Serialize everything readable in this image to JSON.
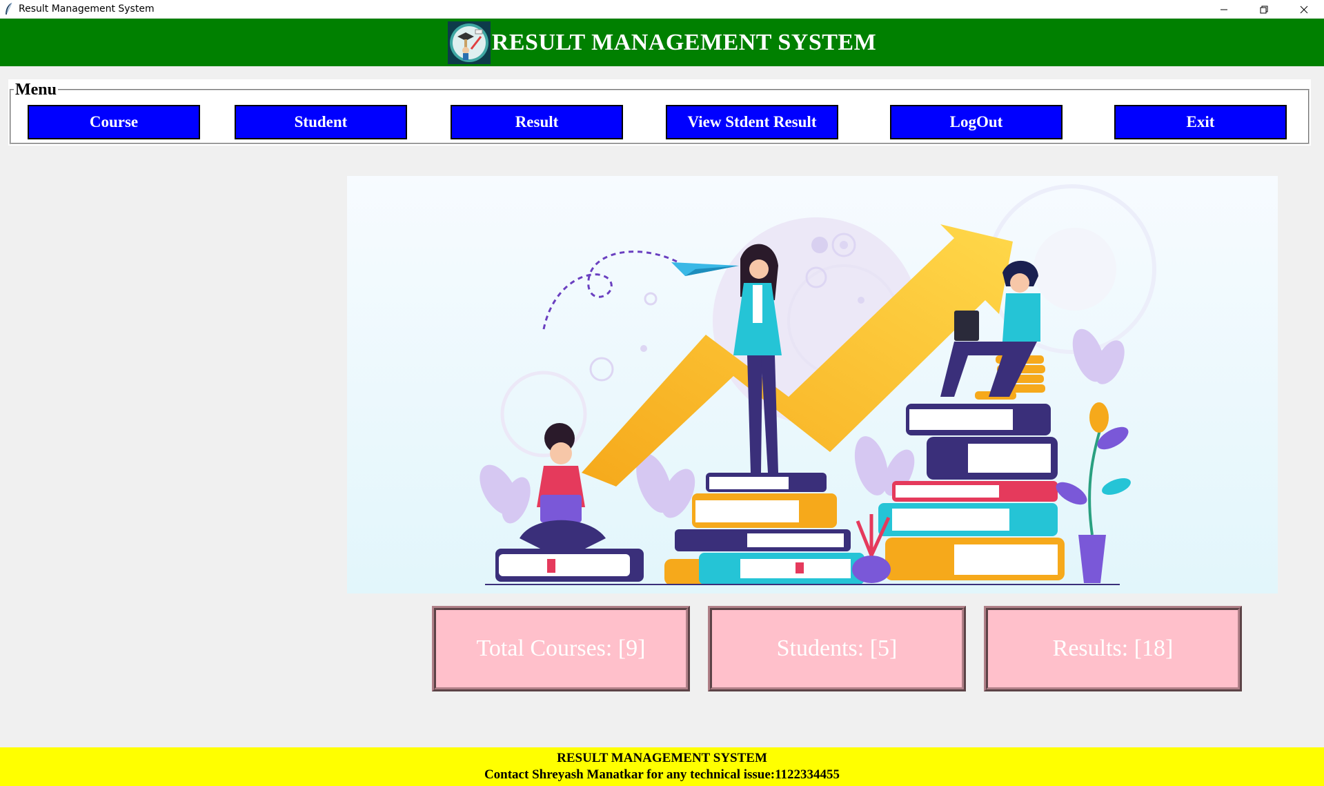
{
  "window": {
    "title": "Result Management System"
  },
  "header": {
    "title": "RESULT MANAGEMENT SYSTEM",
    "logo_icon": "graduation-logo-icon"
  },
  "menu": {
    "legend": "Menu",
    "buttons": [
      {
        "label": "Course"
      },
      {
        "label": "Student"
      },
      {
        "label": "Result"
      },
      {
        "label": "View Stdent Result"
      },
      {
        "label": "LogOut"
      },
      {
        "label": "Exit"
      }
    ]
  },
  "stats": {
    "courses": "Total Courses: [9]",
    "students": "Students: [5]",
    "results": "Results: [18]"
  },
  "footer": {
    "line1": "RESULT MANAGEMENT SYSTEM",
    "line2": "Contact Shreyash Manatkar for any technical issue:1122334455"
  },
  "colors": {
    "header_bg": "#008000",
    "button_bg": "#0000ff",
    "stat_bg": "#ffc0cb",
    "footer_bg": "#ffff00"
  }
}
